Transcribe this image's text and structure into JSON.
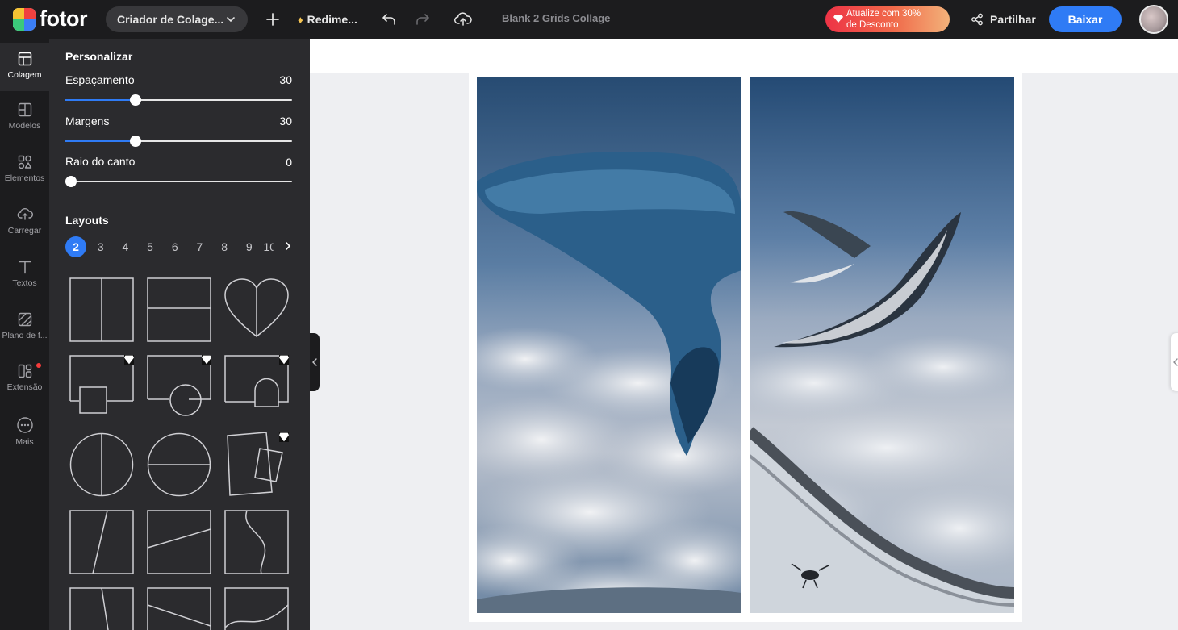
{
  "app": {
    "name": "fotor"
  },
  "topbar": {
    "mode_label": "Criador de Colage...",
    "resize_label": "Redime...",
    "doc_title": "Blank 2 Grids Collage",
    "promo_line1": "Atualize com 30%",
    "promo_line2": "de Desconto",
    "share_label": "Partilhar",
    "download_label": "Baixar"
  },
  "rail": [
    {
      "label": "Colagem",
      "icon": "collage-icon",
      "active": true
    },
    {
      "label": "Modelos",
      "icon": "templates-icon"
    },
    {
      "label": "Elementos",
      "icon": "elements-icon"
    },
    {
      "label": "Carregar",
      "icon": "upload-icon"
    },
    {
      "label": "Textos",
      "icon": "text-icon"
    },
    {
      "label": "Plano de f...",
      "icon": "background-icon"
    },
    {
      "label": "Extensão",
      "icon": "extension-icon",
      "badge": true
    },
    {
      "label": "Mais",
      "icon": "more-icon"
    }
  ],
  "panel": {
    "customize_title": "Personalizar",
    "sliders": [
      {
        "label": "Espaçamento",
        "value": "30",
        "fraction": 0.31
      },
      {
        "label": "Margens",
        "value": "30",
        "fraction": 0.31
      },
      {
        "label": "Raio do canto",
        "value": "0",
        "fraction": 0
      }
    ],
    "layouts_title": "Layouts",
    "layout_tabs": [
      "2",
      "3",
      "4",
      "5",
      "6",
      "7",
      "8",
      "9",
      "10"
    ],
    "active_tab": "2"
  },
  "colors": {
    "accent": "#2f7bf5",
    "topbar": "#1c1c1e",
    "panel": "#2b2b2e",
    "premium": "#f5c453"
  }
}
